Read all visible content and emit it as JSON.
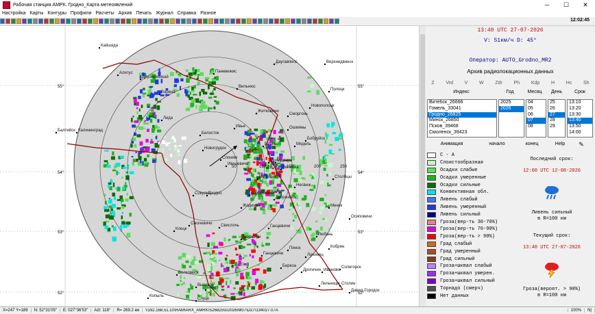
{
  "window": {
    "title": "Рабочая станция АМРК. Гродно_Карта метеоявлений",
    "minimize": "─",
    "maximize": "☐",
    "close": "✕"
  },
  "menu": [
    "Настройка",
    "Карты",
    "Контуры",
    "Профили",
    "Расчеты",
    "Архив",
    "Печать",
    "Журнал",
    "Справка",
    "Разное"
  ],
  "clock": "12:02:45",
  "map": {
    "lat_labels": [
      "55°",
      "54°",
      "53°",
      "52°"
    ],
    "lon_labels": [
      "55°",
      "54°",
      "53°",
      "52°"
    ],
    "range_labels": [
      "50",
      "100",
      "150",
      "200",
      "250"
    ],
    "cities": [
      "Кайшяда",
      "Алитус",
      "Друскининкай",
      "Варена",
      "Лида",
      "Новогрудок",
      "Слоним",
      "Ивацевичи",
      "Барановичи",
      "Ганцевичи",
      "Пинск",
      "Лунинец",
      "Кобрин",
      "Брест",
      "Высокое",
      "Волковыск",
      "Свислочь",
      "Гродно",
      "Сокулка",
      "Белосток",
      "Калининград",
      "Балтийск",
      "Вильнюс",
      "Паневежис",
      "Даугавпилс",
      "Верхнедвинск",
      "Полоцк",
      "Новополоцк",
      "Мядель",
      "Вилейка",
      "Молодечно",
      "Воложин",
      "Дзержинск",
      "Несвиж",
      "Столбцы",
      "Минск",
      "Осиповичи",
      "Солигорск",
      "Лельчицы",
      "Петриков",
      "Мозырь",
      "Ельск",
      "Житковичи",
      "Сморгонь",
      "Ошмяны",
      "Ивье",
      "Жодино",
      "Смолевичи",
      "Бобруйск",
      "Любань",
      "Слуцк",
      "Копыль",
      "Клецк",
      "Ляховичи",
      "Ганцевичи",
      "Береза",
      "Дрогичин",
      "Иваново",
      "Столин",
      "Давид-Городок"
    ]
  },
  "status": {
    "cursor": "X=247 Y=189",
    "lat": "N: 52°31'05\"",
    "lon": "E: 027°36'53\"",
    "az": "Azt: 118°",
    "r": "R= 269.2 км",
    "path": "\\\\192.168.51.10\\RAM\\ARX_AMRK\\S26825\\G2026\\M07\\D27\\134027.07A",
    "zoom": "100%",
    "nl": "N|"
  },
  "info": {
    "time": "13:40 UTC 27-07-2026",
    "velocity": "V: 51км/ч D: 45°",
    "operator": "Оператор: AUTO_Grodno_MR2"
  },
  "archive": {
    "title": "Архив радиолокационных данных",
    "products": [
      "Z",
      "Vrd",
      "V",
      "W",
      "Zdr",
      "Ph",
      "Kdp",
      "H",
      "Hc",
      "Sh"
    ],
    "headers": {
      "index": "Индекс",
      "year": "Год",
      "month": "Месяц",
      "day": "День",
      "time": "Срок"
    },
    "stations": [
      "Витебск_26666",
      "Гомель_33041",
      "Гродно_26825",
      "Минск_26850",
      "Псков_39468",
      "Смоленск_39423"
    ],
    "years": [
      "2025",
      "2026"
    ],
    "months": [
      "04",
      "05",
      "06",
      "07",
      "08"
    ],
    "days": [
      "25",
      "26",
      "27",
      "28",
      "29"
    ],
    "times": [
      "13:10",
      "13:20",
      "13:30",
      "13:40",
      "13:50",
      "14:00"
    ],
    "buttons": {
      "animation": "Анимация",
      "start": "начало",
      "end": "конец",
      "help": "Help"
    }
  },
  "legend": [
    {
      "label": "С - А",
      "color": "#ffffff"
    },
    {
      "label": "Слоистообразная",
      "color": "#c8f5c8"
    },
    {
      "label": "Осадки слабые",
      "color": "#5ddc5d"
    },
    {
      "label": "Осадки умеренные",
      "color": "#22b022"
    },
    {
      "label": "Осадки сильные",
      "color": "#0b6e0b"
    },
    {
      "label": "Конвективная обл.",
      "color": "#00e6e6"
    },
    {
      "label": "Ливень слабый",
      "color": "#3c78ff"
    },
    {
      "label": "Ливень умеренный",
      "color": "#1f3ce0"
    },
    {
      "label": "Ливень сильный",
      "color": "#00008b"
    },
    {
      "label": "Гроза(вер-ть 30-70%)",
      "color": "#f08080"
    },
    {
      "label": "Гроза(вер-ть 70-90%)",
      "color": "#e600e6"
    },
    {
      "label": "Гроза(вер-ть > 90%)",
      "color": "#ff0000"
    },
    {
      "label": "Град слабый",
      "color": "#d2691e"
    },
    {
      "label": "Град умеренный",
      "color": "#a0522d"
    },
    {
      "label": "Град сильный",
      "color": "#8b3a1a"
    },
    {
      "label": "Гроза+шквал слабый",
      "color": "#c080ff"
    },
    {
      "label": "Гроза+шквал умерен.",
      "color": "#9a30ee"
    },
    {
      "label": "Гроза+шквал сильный",
      "color": "#7a00cc"
    },
    {
      "label": "Торнадо (смерч)",
      "color": "#505050"
    },
    {
      "label": "Нет данных",
      "color": "#000000"
    }
  ],
  "forecast_last": {
    "title": "Последний срок:",
    "time": "12:00 UTC 12-08-2026",
    "phenomenon": "Ливень сильный",
    "radius": "в R=100 км"
  },
  "forecast_current": {
    "title": "Текущий срок:",
    "time": "13:40 UTC 27-07-2026",
    "phenomenon": "Гроза(вероят. > 90%)",
    "radius": "в R=100 км"
  }
}
